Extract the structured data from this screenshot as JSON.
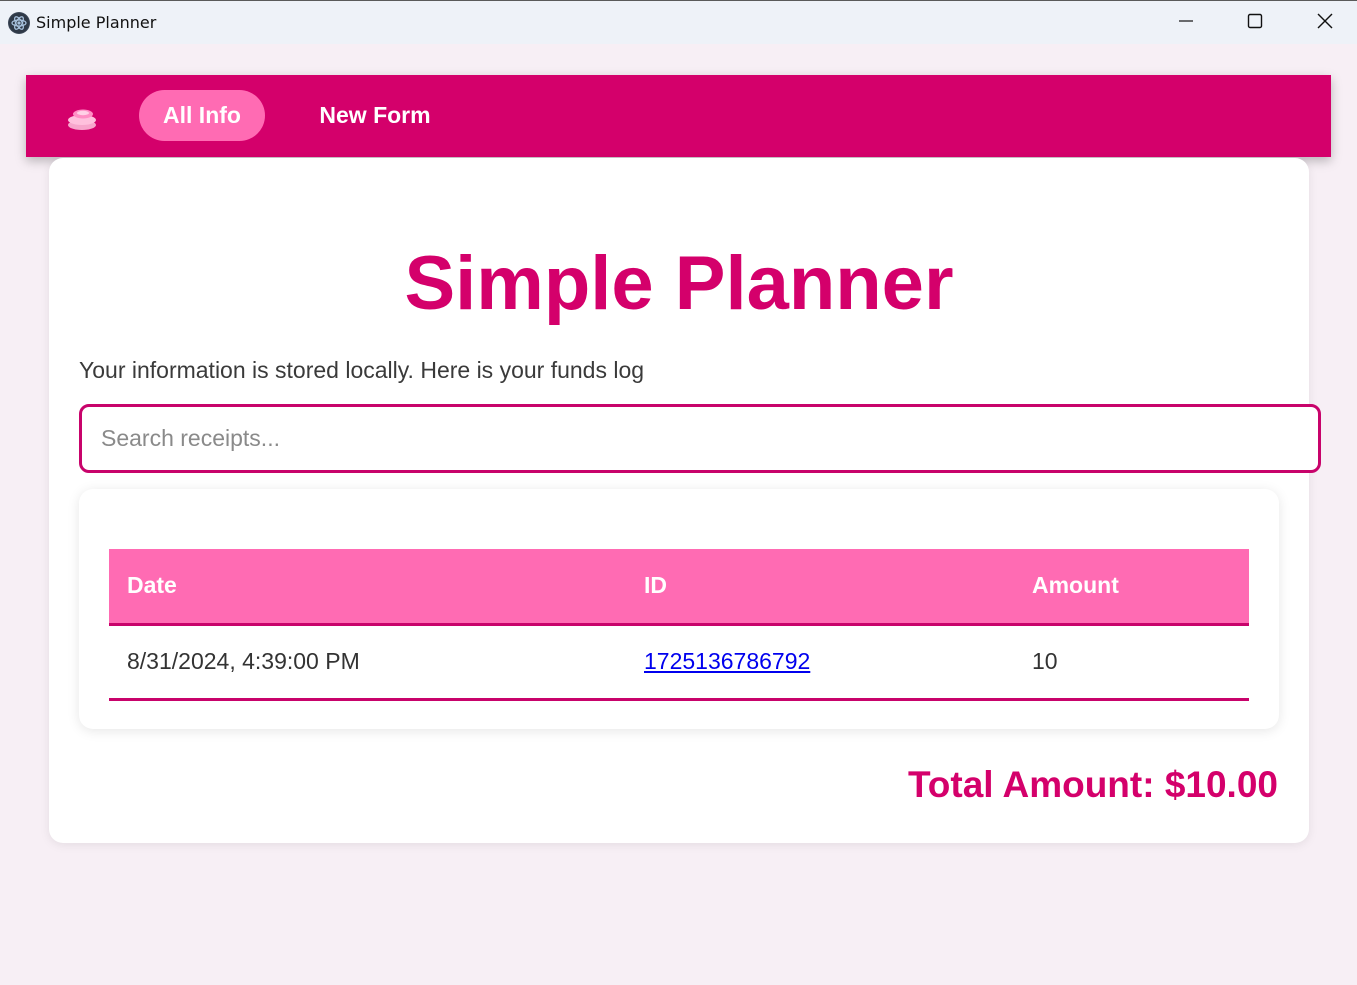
{
  "window": {
    "title": "Simple Planner"
  },
  "nav": {
    "items": [
      {
        "label": "All Info",
        "active": true
      },
      {
        "label": "New Form",
        "active": false
      }
    ]
  },
  "main": {
    "title": "Simple Planner",
    "subtitle": "Your information is stored locally. Here is your funds log",
    "search": {
      "placeholder": "Search receipts...",
      "value": ""
    },
    "table": {
      "columns": [
        "Date",
        "ID",
        "Amount"
      ],
      "rows": [
        {
          "date": "8/31/2024, 4:39:00 PM",
          "id": "1725136786792",
          "amount": "10"
        }
      ]
    },
    "total_text": "Total Amount: $10.00"
  },
  "colors": {
    "brand": "#d4006b",
    "accent_pink": "#ff6bb3",
    "background": "#f7eff5"
  },
  "icons": {
    "app": "electron-icon",
    "logo": "coins-stack-icon",
    "minimize": "minimize-icon",
    "maximize": "maximize-icon",
    "close": "close-icon"
  }
}
